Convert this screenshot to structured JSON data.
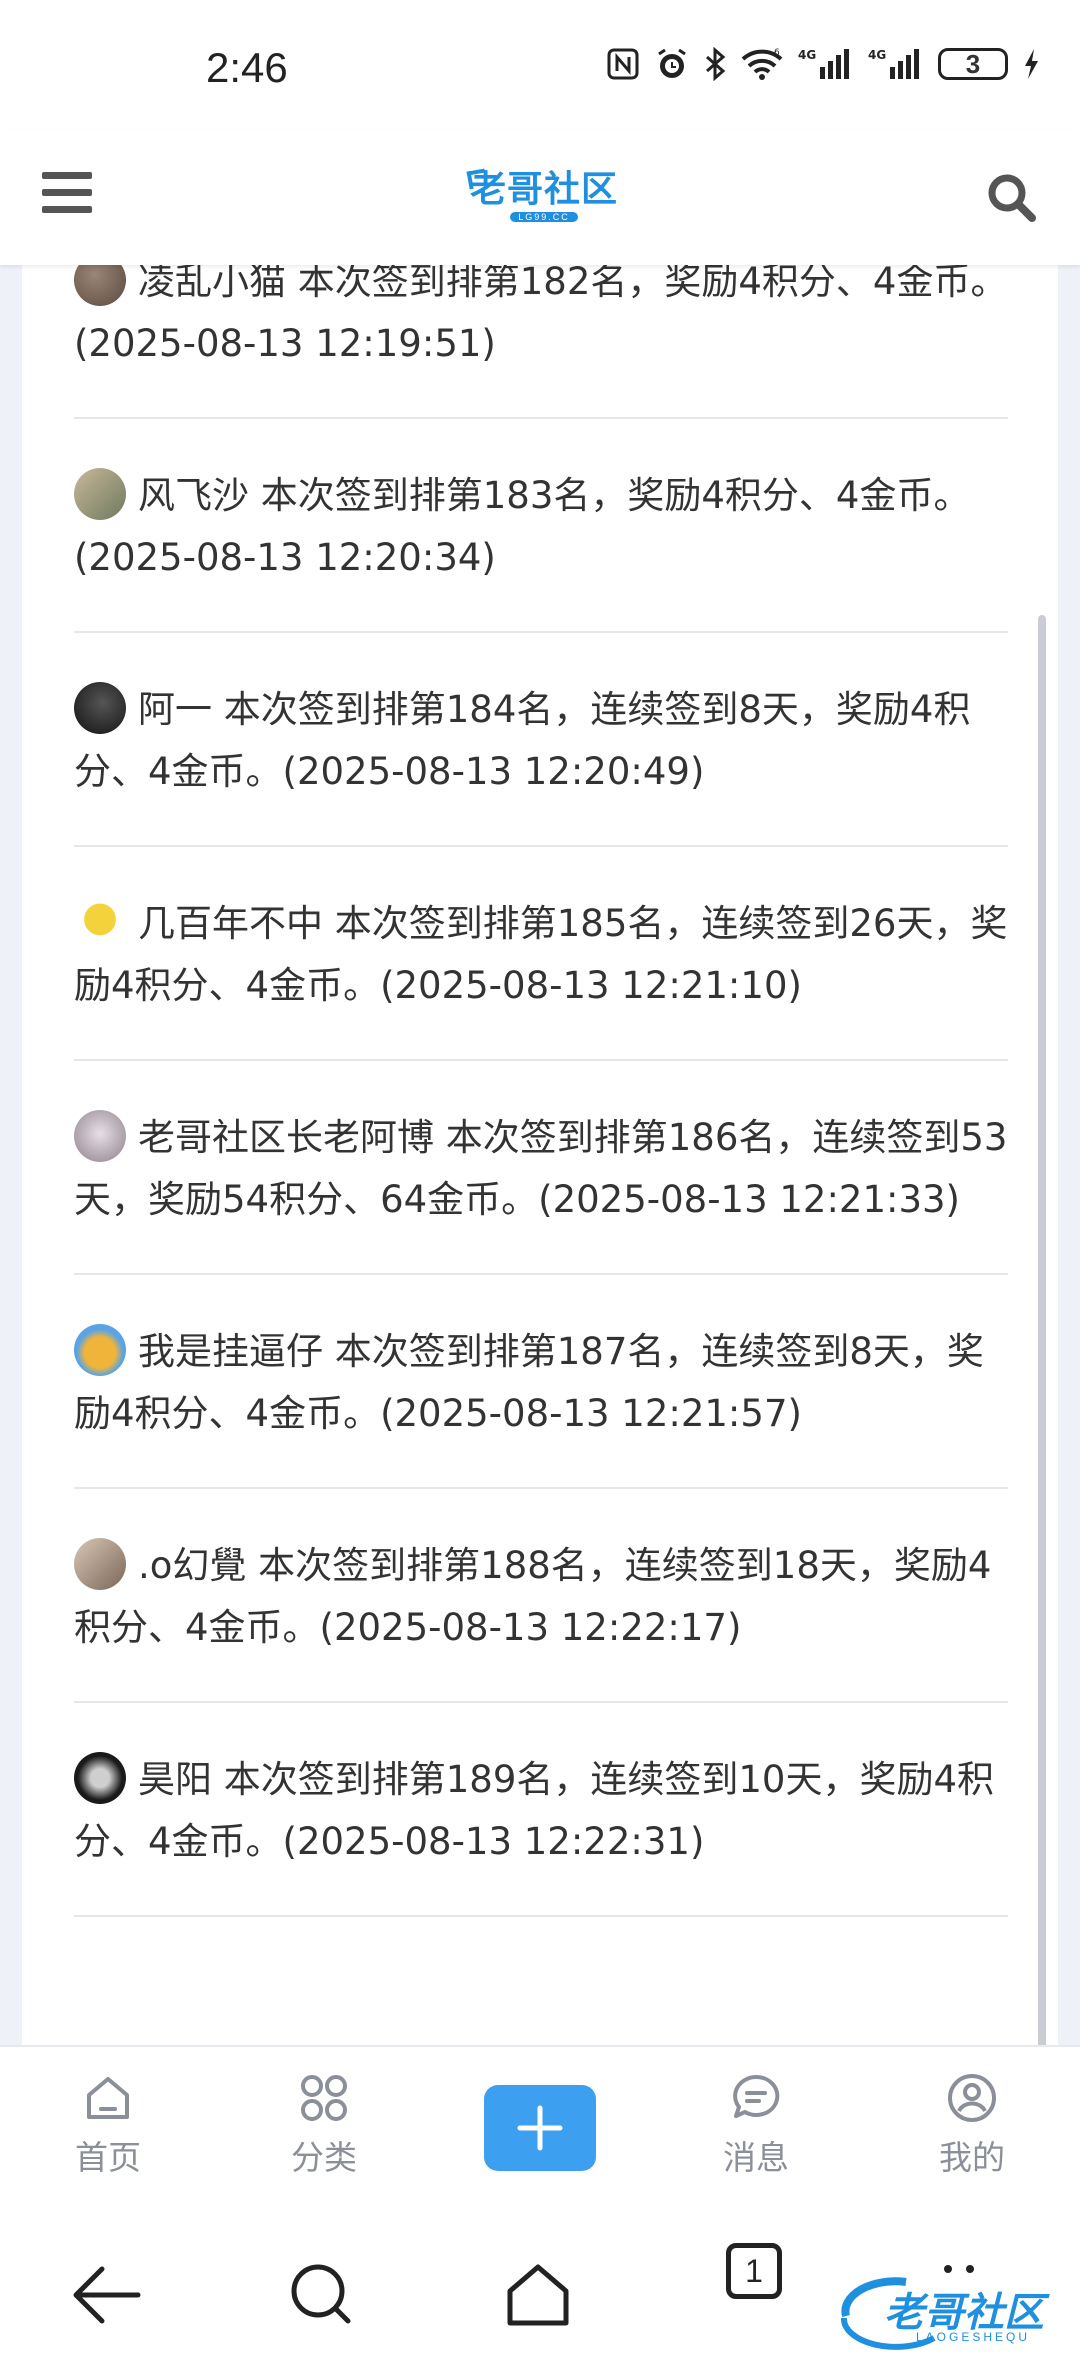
{
  "status_bar": {
    "time": "2:46",
    "signal_1": "4G",
    "signal_2": "4G",
    "wifi_tag": "6",
    "battery": "3",
    "icons": [
      "nfc-icon",
      "alarm-icon",
      "bluetooth-icon",
      "wifi-icon",
      "signal-icon",
      "signal-icon",
      "battery-icon",
      "charging-icon"
    ]
  },
  "header": {
    "logo_text": "老哥社区",
    "logo_sub": "LG99.CC",
    "icons": [
      "menu-icon",
      "search-icon"
    ]
  },
  "checkins": [
    {
      "text": "凌乱小猫 本次签到排第182名，奖励4积分、4金币。(2025-08-13 12:19:51)"
    },
    {
      "text": "风飞沙 本次签到排第183名，奖励4积分、4金币。(2025-08-13 12:20:34)"
    },
    {
      "text": "阿一 本次签到排第184名，连续签到8天，奖励4积分、4金币。(2025-08-13 12:20:49)"
    },
    {
      "text": "几百年不中 本次签到排第185名，连续签到26天，奖励4积分、4金币。(2025-08-13 12:21:10)"
    },
    {
      "text": "老哥社区长老阿博 本次签到排第186名，连续签到53天，奖励54积分、64金币。(2025-08-13 12:21:33)"
    },
    {
      "text": "我是挂逼仔 本次签到排第187名，连续签到8天，奖励4积分、4金币。(2025-08-13 12:21:57)"
    },
    {
      "text": ".o幻覺 本次签到排第188名，连续签到18天，奖励4积分、4金币。(2025-08-13 12:22:17)"
    },
    {
      "text": "昊阳 本次签到排第189名，连续签到10天，奖励4积分、4金币。(2025-08-13 12:22:31)"
    }
  ],
  "bottom_nav": {
    "home": "首页",
    "category": "分类",
    "messages": "消息",
    "me": "我的"
  },
  "system_nav": {
    "tab_count": "1"
  },
  "watermark": {
    "text": "老哥社区",
    "sub": "LAOGESHEQU"
  },
  "colors": {
    "accent": "#3d9ff0",
    "brand": "#1f8fe0",
    "nav_label": "#8a8f99"
  }
}
